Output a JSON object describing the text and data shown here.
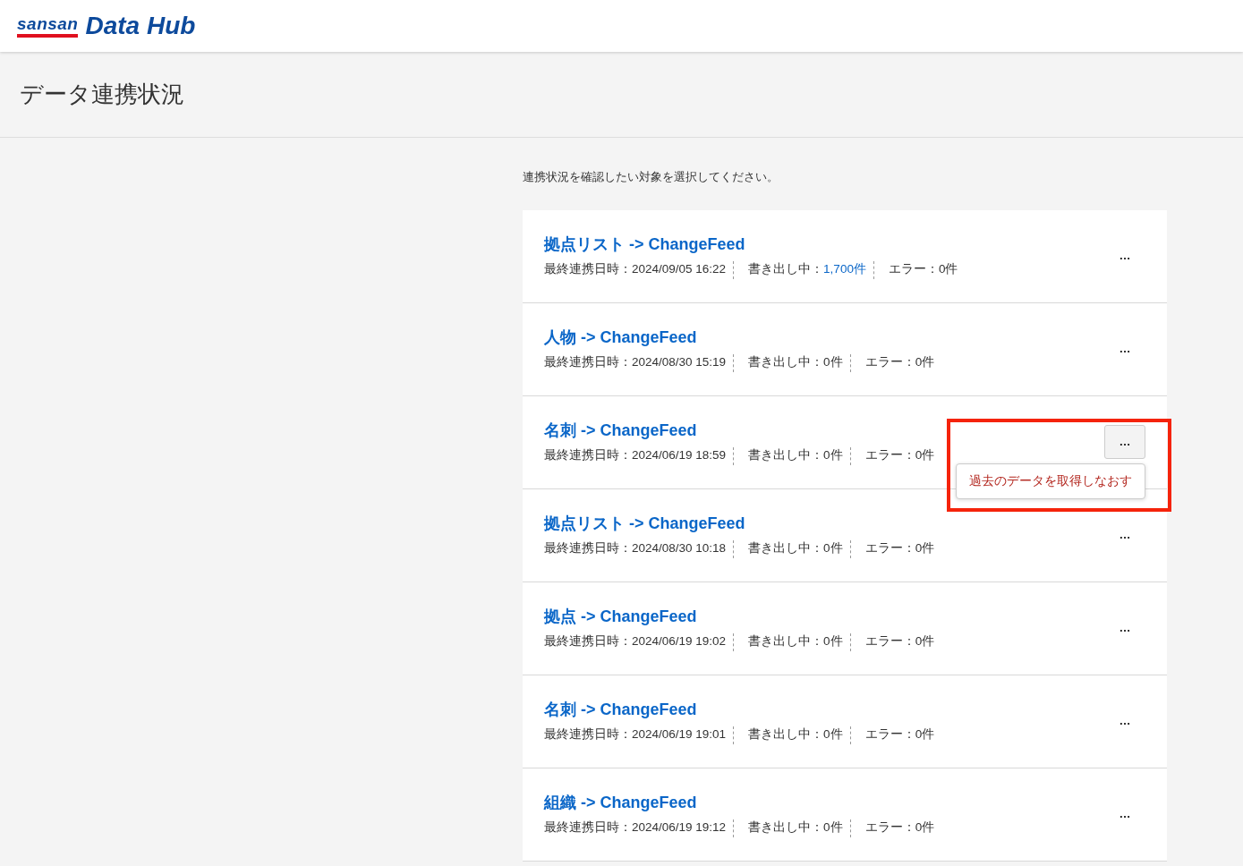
{
  "logo": {
    "brand": "sansan",
    "product": "Data Hub"
  },
  "page_title": "データ連携状況",
  "instruction": "連携状況を確認したい対象を選択してください。",
  "items": [
    {
      "title": "拠点リスト -> ChangeFeed",
      "last_sync": "最終連携日時：2024/09/05 16:22",
      "export_label": "書き出し中：",
      "export_count": "1,700件",
      "exporting": true,
      "errors": "エラー：0件",
      "menu_label": "…",
      "menu_open": false
    },
    {
      "title": "人物 -> ChangeFeed",
      "last_sync": "最終連携日時：2024/08/30 15:19",
      "export_label": "書き出し中：",
      "export_count": "0件",
      "exporting": false,
      "errors": "エラー：0件",
      "menu_label": "…",
      "menu_open": false
    },
    {
      "title": "名刺 -> ChangeFeed",
      "last_sync": "最終連携日時：2024/06/19 18:59",
      "export_label": "書き出し中：",
      "export_count": "0件",
      "exporting": false,
      "errors": "エラー：0件",
      "menu_label": "…",
      "menu_open": true,
      "menu_items": [
        "過去のデータを取得しなおす"
      ],
      "highlighted": true
    },
    {
      "title": "拠点リスト -> ChangeFeed",
      "last_sync": "最終連携日時：2024/08/30 10:18",
      "export_label": "書き出し中：",
      "export_count": "0件",
      "exporting": false,
      "errors": "エラー：0件",
      "menu_label": "…",
      "menu_open": false
    },
    {
      "title": "拠点 -> ChangeFeed",
      "last_sync": "最終連携日時：2024/06/19 19:02",
      "export_label": "書き出し中：",
      "export_count": "0件",
      "exporting": false,
      "errors": "エラー：0件",
      "menu_label": "…",
      "menu_open": false
    },
    {
      "title": "名刺 -> ChangeFeed",
      "last_sync": "最終連携日時：2024/06/19 19:01",
      "export_label": "書き出し中：",
      "export_count": "0件",
      "exporting": false,
      "errors": "エラー：0件",
      "menu_label": "…",
      "menu_open": false
    },
    {
      "title": "組織 -> ChangeFeed",
      "last_sync": "最終連携日時：2024/06/19 19:12",
      "export_label": "書き出し中：",
      "export_count": "0件",
      "exporting": false,
      "errors": "エラー：0件",
      "menu_label": "…",
      "menu_open": false
    }
  ]
}
